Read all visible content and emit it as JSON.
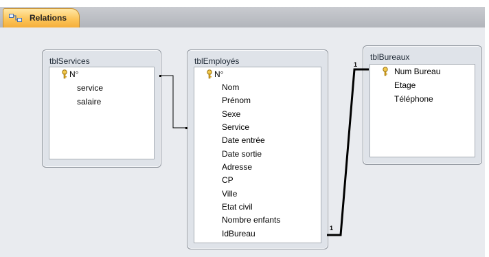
{
  "tab": {
    "label": "Relations",
    "icon": "relationships-icon"
  },
  "tables": {
    "services": {
      "title": "tblServices",
      "fields": [
        "N°",
        "service",
        "salaire"
      ]
    },
    "employes": {
      "title": "tblEmployés",
      "fields": [
        "N°",
        "Nom",
        "Prénom",
        "Sexe",
        "Service",
        "Date entrée",
        "Date sortie",
        "Adresse",
        "CP",
        "Ville",
        "Etat civil",
        "Nombre enfants",
        "IdBureau"
      ]
    },
    "bureaux": {
      "title": "tblBureaux",
      "fields": [
        "Num Bureau",
        "Etage",
        "Téléphone"
      ]
    }
  },
  "relationships": [
    {
      "from": "tblServices.N°",
      "to": "tblEmployés.Service",
      "from_label": "",
      "to_label": ""
    },
    {
      "from": "tblEmployés.IdBureau",
      "to": "tblBureaux.Num Bureau",
      "from_label": "1",
      "to_label": "1"
    }
  ],
  "colors": {
    "tab": "#fcc55a",
    "canvas": "#e9ebef",
    "table_frame": "#dfe3e9",
    "key": "#d8a21a"
  }
}
